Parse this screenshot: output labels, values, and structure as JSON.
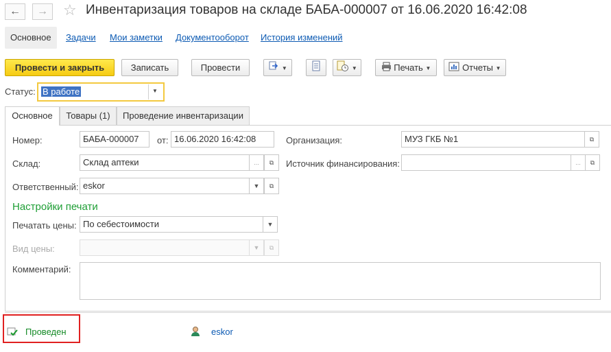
{
  "window": {
    "title": "Инвентаризация товаров на складе БАБА-000007 от 16.06.2020 16:42:08"
  },
  "top_tabs": {
    "main": "Основное",
    "tasks": "Задачи",
    "notes": "Мои заметки",
    "docflow": "Документооборот",
    "history": "История изменений"
  },
  "toolbar": {
    "post_and_close": "Провести и закрыть",
    "save": "Записать",
    "post": "Провести",
    "print": "Печать",
    "reports": "Отчеты"
  },
  "status": {
    "label": "Статус:",
    "value": "В работе"
  },
  "form_tabs": {
    "main": "Основное",
    "goods": "Товары (1)",
    "inventory": "Проведение инвентаризации"
  },
  "fields": {
    "number_label": "Номер:",
    "number_value": "БАБА-000007",
    "date_label": "от:",
    "date_value": "16.06.2020 16:42:08",
    "org_label": "Организация:",
    "org_value": "МУЗ ГКБ №1",
    "warehouse_label": "Склад:",
    "warehouse_value": "Склад аптеки",
    "funding_label": "Источник финансирования:",
    "funding_value": "",
    "responsible_label": "Ответственный:",
    "responsible_value": "eskor"
  },
  "print_settings": {
    "title": "Настройки печати",
    "print_prices_label": "Печатать цены:",
    "print_prices_value": "По себестоимости",
    "price_type_label": "Вид цены:",
    "price_type_value": ""
  },
  "comment": {
    "label": "Комментарий:",
    "value": ""
  },
  "footer": {
    "posted": "Проведен",
    "user": "eskor"
  },
  "colors": {
    "primary_button": "#f6cb13",
    "section_title": "#1e9e35",
    "link": "#0c5ab3",
    "highlight_border": "#e02020"
  }
}
